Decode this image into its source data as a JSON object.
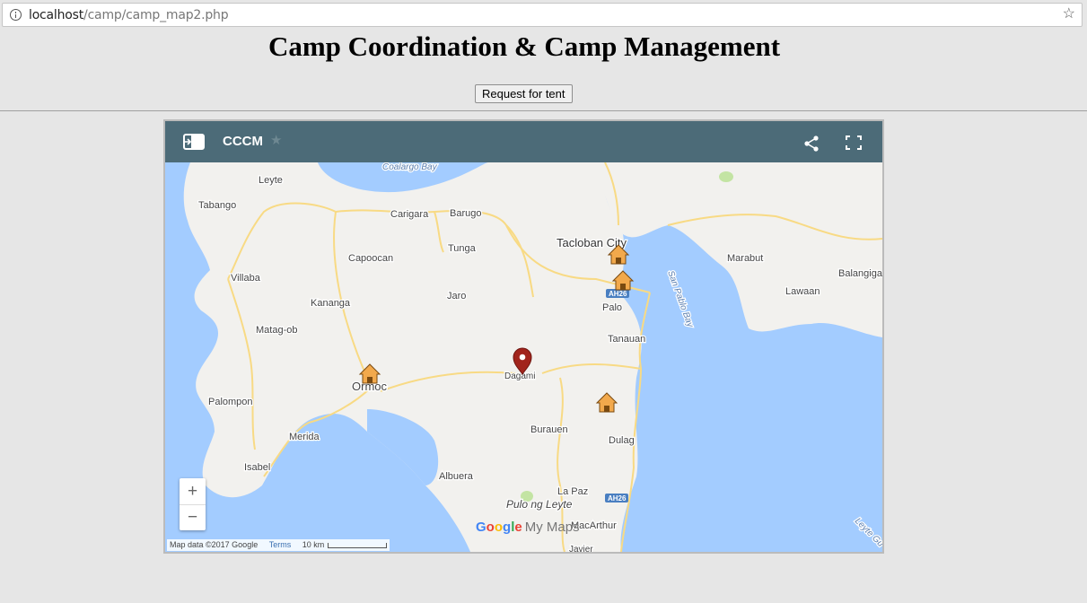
{
  "browser": {
    "url_host": "localhost",
    "url_path": "/camp/camp_map2.php",
    "bookmark_icon": "star-icon",
    "info_icon": "info-icon"
  },
  "page": {
    "title": "Camp Coordination & Camp Management",
    "request_button": "Request for tent"
  },
  "map": {
    "title": "CCCM",
    "header_icons": [
      "sidebar-toggle-icon",
      "star-icon",
      "share-icon",
      "fullscreen-icon"
    ],
    "zoom_in": "+",
    "zoom_out": "−",
    "attribution": {
      "map_data": "Map data ©2017 Google",
      "terms": "Terms",
      "scale": "10 km"
    },
    "logo": "Google My Maps",
    "place_labels": {
      "coalargo": "Coalargo Bay",
      "leyte": "Leyte",
      "tabango": "Tabango",
      "carigara": "Carigara",
      "barugo": "Barugo",
      "tacloban": "Tacloban City",
      "tunga": "Tunga",
      "capoocan": "Capoocan",
      "marabut": "Marabut",
      "balangiga": "Balangiga",
      "villaba": "Villaba",
      "sanpablo": "San Pablo Bay",
      "lawaan": "Lawaan",
      "jaro": "Jaro",
      "kananga": "Kananga",
      "palo": "Palo",
      "matagob": "Matag-ob",
      "tanauan": "Tanauan",
      "dagami": "Dagami",
      "ormoc": "Ormoc",
      "palompon": "Palompon",
      "burauen": "Burauen",
      "dulag": "Dulag",
      "merida": "Merida",
      "isabel": "Isabel",
      "albuera": "Albuera",
      "lapaz": "La Paz",
      "pulong": "Pulo ng Leyte",
      "macarthur": "MacArthur",
      "javier": "Javier",
      "leytegulf": "Leyte Gu",
      "ah26a": "AH26",
      "ah26b": "AH26"
    },
    "markers": [
      {
        "type": "camp-icon"
      },
      {
        "type": "camp-icon"
      },
      {
        "type": "camp-icon"
      },
      {
        "type": "camp-icon"
      },
      {
        "type": "location-pin-icon"
      }
    ],
    "colors": {
      "header": "#4c6b78",
      "water": "#a3ccff",
      "land": "#f2f1ee",
      "road": "#f8da84",
      "camp_marker": "#f2a94c",
      "pin": "#a1241c"
    }
  }
}
